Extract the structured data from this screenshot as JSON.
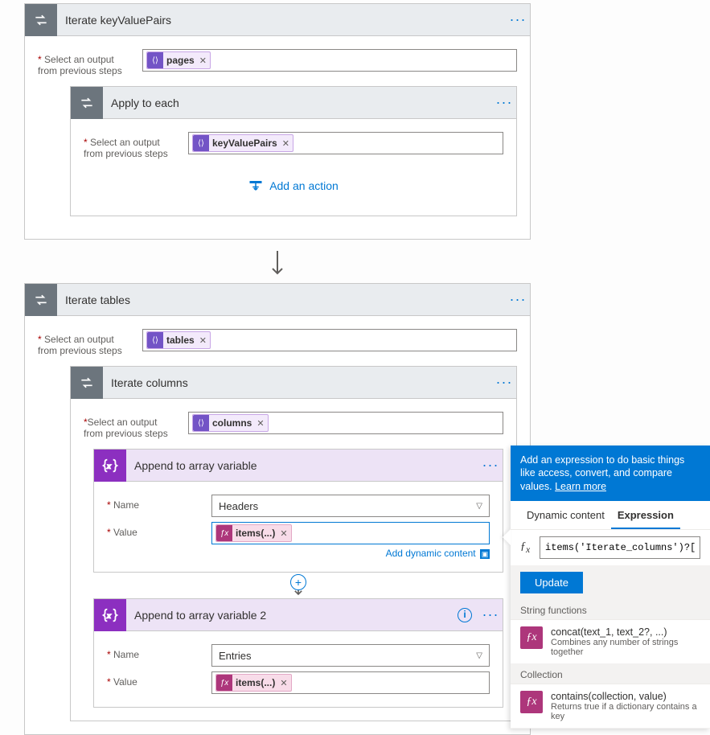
{
  "outer1": {
    "title": "Iterate keyValuePairs",
    "sel_label_1": "Select an output",
    "sel_label_2": "from previous steps",
    "token": "pages",
    "inner": {
      "title": "Apply to each",
      "sel_label_1": "Select an output",
      "sel_label_2": "from previous steps",
      "token": "keyValuePairs",
      "add_action": "Add an action"
    }
  },
  "outer2": {
    "title": "Iterate tables",
    "sel_label_1": "Select an output",
    "sel_label_2": "from previous steps",
    "token": "tables",
    "inner": {
      "title": "Iterate columns",
      "sel_label_1": "Select an output",
      "sel_label_2": "from previous steps",
      "token": "columns",
      "append1": {
        "title": "Append to array variable",
        "name_label": "Name",
        "name_value": "Headers",
        "value_label": "Value",
        "value_token": "items(...)",
        "dyn_link": "Add dynamic content"
      },
      "append2": {
        "title": "Append to array variable 2",
        "name_label": "Name",
        "name_value": "Entries",
        "value_label": "Value",
        "value_token": "items(...)"
      }
    }
  },
  "expr": {
    "head_text": "Add an expression to do basic things like access, convert, and compare values. ",
    "learn_more": "Learn more",
    "tab_dynamic": "Dynamic content",
    "tab_expression": "Expression",
    "formula": "items('Iterate_columns')?['he",
    "update": "Update",
    "group1": "String functions",
    "fn1_name": "concat(text_1, text_2?, ...)",
    "fn1_desc": "Combines any number of strings together",
    "group2": "Collection",
    "fn2_name": "contains(collection, value)",
    "fn2_desc": "Returns true if a dictionary contains a key"
  }
}
